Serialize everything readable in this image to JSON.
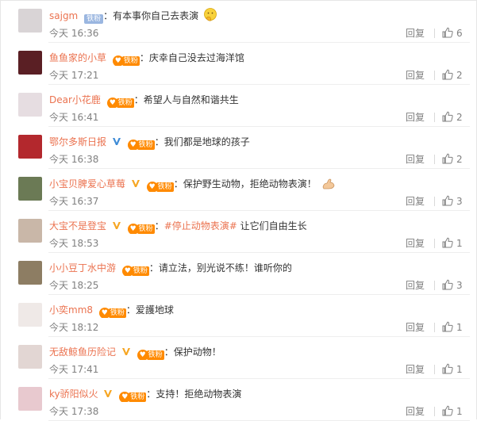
{
  "comments": [
    {
      "avatar_color": "#d9d4d6",
      "username": "sajgm",
      "verified": false,
      "fan_badge": "铁粉",
      "fan_style": "blue",
      "text": "有本事你自己去表演",
      "topic": "",
      "text_after": "",
      "emoji": "thinking-emoji",
      "time": "今天 16:36",
      "reply": "回复",
      "likes": "6"
    },
    {
      "avatar_color": "#5a1f24",
      "username": "鱼鱼家的小草",
      "verified": false,
      "fan_badge": "铁粉",
      "fan_style": "orange",
      "text": "庆幸自己没去过海洋馆",
      "topic": "",
      "text_after": "",
      "emoji": "",
      "time": "今天 17:21",
      "reply": "回复",
      "likes": "2"
    },
    {
      "avatar_color": "#e6dde1",
      "username": "Dear小花鹿",
      "verified": false,
      "fan_badge": "铁粉",
      "fan_style": "orange",
      "text": "希望人与自然和谐共生",
      "topic": "",
      "text_after": "",
      "emoji": "",
      "time": "今天 16:41",
      "reply": "回复",
      "likes": "2"
    },
    {
      "avatar_color": "#b3282d",
      "username": "鄂尔多斯日报",
      "verified": true,
      "verified_color": "#3e8bd6",
      "fan_badge": "铁粉",
      "fan_style": "orange",
      "text": "我们都是地球的孩子",
      "topic": "",
      "text_after": "",
      "emoji": "",
      "time": "今天 16:38",
      "reply": "回复",
      "likes": "2"
    },
    {
      "avatar_color": "#6b7a55",
      "username": "小宝贝脾爱心草莓",
      "verified": true,
      "verified_color": "#f6a623",
      "fan_badge": "铁粉",
      "fan_style": "orange",
      "text": "保护野生动物，拒绝动物表演！",
      "topic": "",
      "text_after": "",
      "emoji": "muscle-emoji",
      "time": "今天 16:37",
      "reply": "回复",
      "likes": "3"
    },
    {
      "avatar_color": "#c9b7a8",
      "username": "大宝不是登宝",
      "verified": true,
      "verified_color": "#f6a623",
      "fan_badge": "铁粉",
      "fan_style": "orange",
      "text": "",
      "topic": "#停止动物表演#",
      "text_after": " 让它们自由生长",
      "emoji": "",
      "time": "今天 18:53",
      "reply": "回复",
      "likes": "1"
    },
    {
      "avatar_color": "#8d7d63",
      "username": "小小豆丁水中游",
      "verified": false,
      "fan_badge": "铁粉",
      "fan_style": "orange",
      "text": "请立法，别光说不练！谁听你的",
      "topic": "",
      "text_after": "",
      "emoji": "",
      "time": "今天 18:25",
      "reply": "回复",
      "likes": "3"
    },
    {
      "avatar_color": "#efe9e7",
      "username": "小奕mm8",
      "verified": false,
      "fan_badge": "铁粉",
      "fan_style": "orange",
      "text": "爱護地球",
      "topic": "",
      "text_after": "",
      "emoji": "",
      "time": "今天 18:12",
      "reply": "回复",
      "likes": "1"
    },
    {
      "avatar_color": "#e2d6d3",
      "username": "无敌鲸鱼历险记",
      "verified": true,
      "verified_color": "#f6a623",
      "fan_badge": "铁粉",
      "fan_style": "orange",
      "text": "保护动物！",
      "topic": "",
      "text_after": "",
      "emoji": "",
      "time": "今天 17:41",
      "reply": "回复",
      "likes": "1"
    },
    {
      "avatar_color": "#e8c9cf",
      "username": "ky骄阳似火",
      "verified": true,
      "verified_color": "#f6a623",
      "fan_badge": "铁粉",
      "fan_style": "orange",
      "text": "支持！拒绝动物表演",
      "topic": "",
      "text_after": "",
      "emoji": "",
      "time": "今天 17:38",
      "reply": "回复",
      "likes": "1"
    }
  ],
  "colors": {
    "username": "#eb7350",
    "muted": "#808080",
    "fan_orange": "#ff8a00"
  }
}
